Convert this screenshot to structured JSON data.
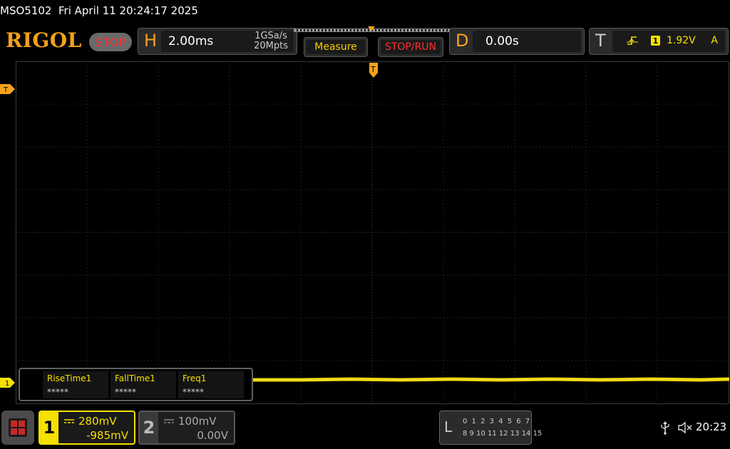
{
  "title": {
    "model": "MSO5102",
    "datetime": "Fri April 11 20:24:17 2025"
  },
  "brand": {
    "logo": "RIGOL",
    "status": "STOP"
  },
  "horizontal": {
    "letter": "H",
    "timebase": "2.00ms",
    "sample_rate": "1GSa/s",
    "memory_depth": "20Mpts"
  },
  "buttons": {
    "measure": "Measure",
    "stop_run": "STOP/RUN"
  },
  "delay": {
    "letter": "D",
    "value": "0.00s"
  },
  "trigger": {
    "letter": "T",
    "source": "1",
    "level": "1.92V",
    "mode": "A",
    "time_marker": "T",
    "level_marker": "T"
  },
  "channel1": {
    "number": "1",
    "scale": "280mV",
    "offset": "-985mV",
    "marker": "1",
    "color": "#f5e000"
  },
  "channel2": {
    "number": "2",
    "scale": "100mV",
    "offset": "0.00V"
  },
  "measurements": [
    {
      "name": "RiseTime1",
      "value": "*****"
    },
    {
      "name": "FallTime1",
      "value": "*****"
    },
    {
      "name": "Freq1",
      "value": "*****"
    }
  ],
  "logic_analyzer": {
    "letter": "L",
    "row1": "0 1 2 3  4 5 6 7",
    "row2": "8 9 10 11 12 13 14 15"
  },
  "status_bar": {
    "time": "20:23",
    "usb_icon": "usb-icon",
    "sound_icon": "mute-icon"
  },
  "colors": {
    "accent": "#f5a21b",
    "stop": "#ff3030",
    "trace": "#f5e000"
  }
}
